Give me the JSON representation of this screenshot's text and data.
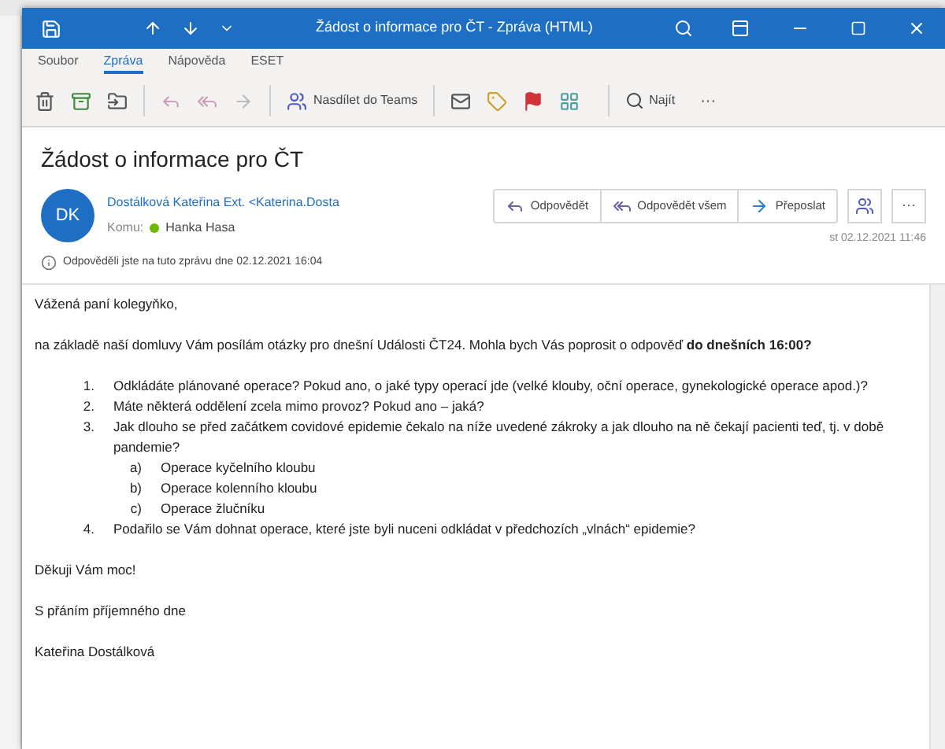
{
  "window": {
    "title": "Žádost o informace pro ČT  -  Zpráva (HTML)"
  },
  "tabs": [
    {
      "label": "Soubor",
      "selected": false
    },
    {
      "label": "Zpráva",
      "selected": true
    },
    {
      "label": "Nápověda",
      "selected": false
    },
    {
      "label": "ESET",
      "selected": false
    }
  ],
  "toolbar": {
    "teams_button": "Nasdílet do Teams",
    "find_button": "Najít",
    "more": "···"
  },
  "message": {
    "subject": "Žádost o informace pro ČT",
    "avatar": "DK",
    "sender": "Dostálková Kateřina Ext. <Katerina.Dosta",
    "to_label": "Komu:",
    "recipient": "Hanka Hasa",
    "info": "Odpověděli jste na tuto zprávu dne 02.12.2021 16:04",
    "date": "st 02.12.2021 11:46",
    "actions": [
      {
        "label": "Odpovědět",
        "kind": "reply"
      },
      {
        "label": "Odpovědět všem",
        "kind": "reply_all"
      },
      {
        "label": "Přeposlat",
        "kind": "forward"
      }
    ],
    "more": "···"
  },
  "body": {
    "greeting": "Vážená paní kolegyňko,",
    "intro": "na základě naší domluvy Vám posílám otázky pro dnešní Události ČT24. Mohla bych Vás poprosit o odpověď **do dnešních 16:00?**",
    "questions": [
      {
        "marker": "1.",
        "text": "Odkládáte plánované operace? Pokud ano, o jaké typy operací jde (velké klouby, oční operace, gynekologické operace apod.)?"
      },
      {
        "marker": "2.",
        "text": "Máte některá oddělení zcela mimo provoz? Pokud ano – jaká?"
      },
      {
        "marker": "3.",
        "text": "Jak dlouho se před začátkem covidové epidemie čekalo na níže uvedené zákroky a jak dlouho na ně čekají pacienti teď, tj. v době pandemie?",
        "children": [
          {
            "marker": "a)",
            "text": "Operace kyčelního kloubu"
          },
          {
            "marker": "b)",
            "text": "Operace kolenního kloubu"
          },
          {
            "marker": "c)",
            "text": "Operace žlučníku"
          }
        ]
      },
      {
        "marker": "4.",
        "text": "Podařilo se Vám dohnat operace, které jste byli nuceni odkládat v předchozích „vlnách“ epidemie?"
      }
    ],
    "thanks": "Děkuji Vám moc!",
    "closing": "S přáním příjemného dne",
    "signature": "Kateřina Dostálková"
  }
}
